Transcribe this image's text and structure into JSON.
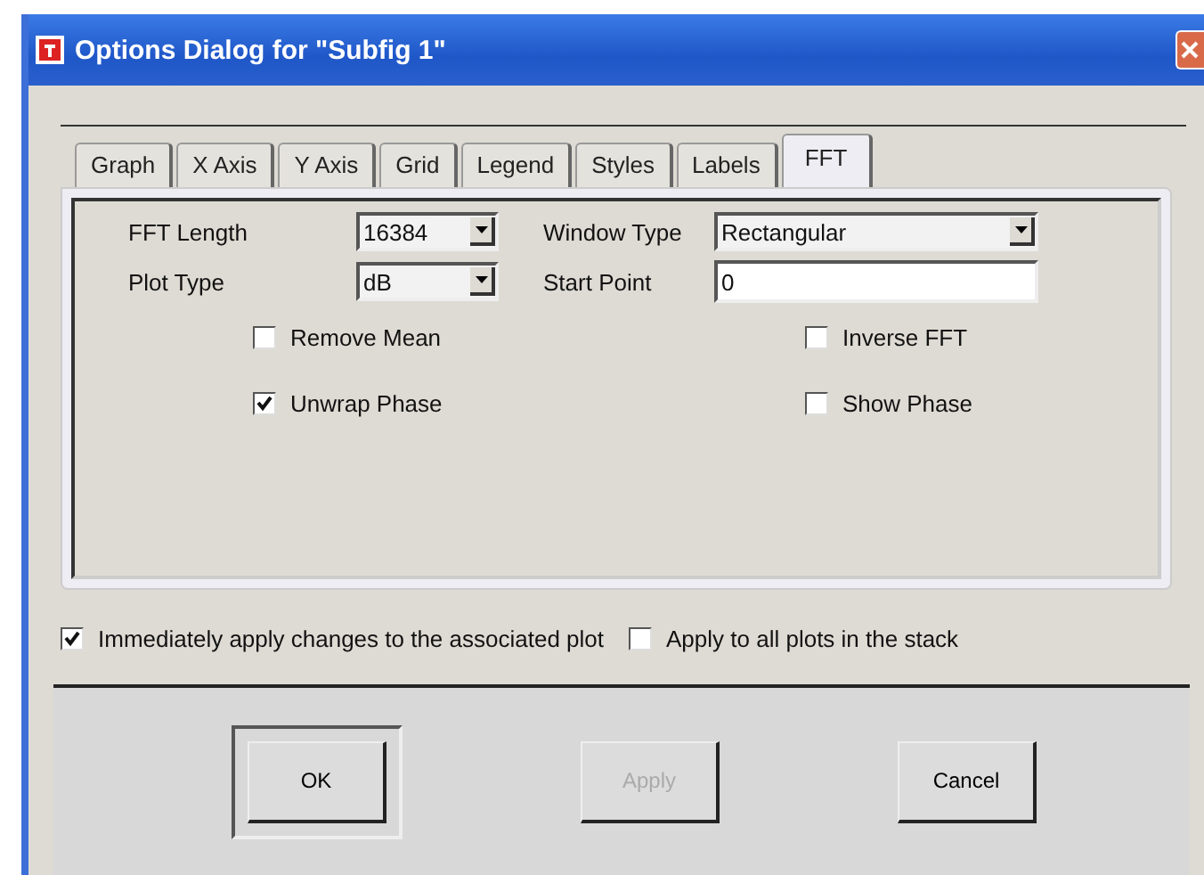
{
  "window": {
    "title": "Options Dialog for \"Subfig 1\""
  },
  "tabs": [
    {
      "label": "Graph",
      "selected": false
    },
    {
      "label": "X Axis",
      "selected": false
    },
    {
      "label": "Y Axis",
      "selected": false
    },
    {
      "label": "Grid",
      "selected": false
    },
    {
      "label": "Legend",
      "selected": false
    },
    {
      "label": "Styles",
      "selected": false
    },
    {
      "label": "Labels",
      "selected": false
    },
    {
      "label": "FFT",
      "selected": true
    }
  ],
  "fields": [
    {
      "label": "FFT Length",
      "kind": "dropdown",
      "value": "16384"
    },
    {
      "label": "Window Type",
      "kind": "dropdown",
      "value": "Rectangular"
    },
    {
      "label": "Plot Type",
      "kind": "dropdown",
      "value": "dB"
    },
    {
      "label": "Start Point",
      "kind": "text",
      "value": "0"
    }
  ],
  "options": [
    {
      "label": "Remove Mean",
      "checked": false
    },
    {
      "label": "Inverse FFT",
      "checked": false
    },
    {
      "label": "Unwrap Phase",
      "checked": true
    },
    {
      "label": "Show Phase",
      "checked": false
    }
  ],
  "footer_options": [
    {
      "label": "Immediately apply changes to the associated plot",
      "checked": true
    },
    {
      "label": "Apply to all plots in the stack",
      "checked": false
    }
  ],
  "buttons": [
    {
      "label": "OK",
      "default": true,
      "disabled": false
    },
    {
      "label": "Apply",
      "default": false,
      "disabled": true
    },
    {
      "label": "Cancel",
      "default": false,
      "disabled": false
    }
  ]
}
